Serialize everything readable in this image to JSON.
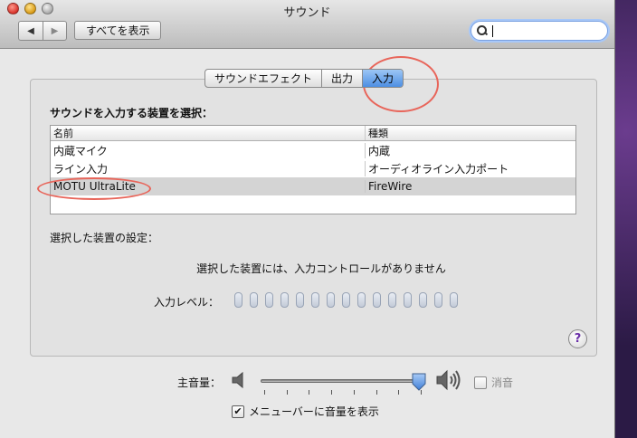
{
  "window": {
    "title": "サウンド"
  },
  "toolbar": {
    "back_glyph": "◀",
    "forward_glyph": "▶",
    "show_all_label": "すべてを表示",
    "search_value": ""
  },
  "tabs": [
    {
      "label": "サウンドエフェクト",
      "active": false
    },
    {
      "label": "出力",
      "active": false
    },
    {
      "label": "入力",
      "active": true
    }
  ],
  "input": {
    "select_label": "サウンドを入力する装置を選択：",
    "columns": [
      "名前",
      "種類"
    ],
    "devices": [
      {
        "name": "内蔵マイク",
        "type": "内蔵",
        "selected": false
      },
      {
        "name": "ライン入力",
        "type": "オーディオライン入力ポート",
        "selected": false
      },
      {
        "name": "MOTU UltraLite",
        "type": "FireWire",
        "selected": true
      }
    ],
    "settings_label": "選択した装置の設定：",
    "no_controls_text": "選択した装置には、入力コントロールがありません",
    "level_label": "入力レベル：",
    "level_segments": 15,
    "level_active_segments": 0
  },
  "help": {
    "glyph": "?"
  },
  "volume": {
    "label": "主音量：",
    "level_fraction": 0.97,
    "mute_label": "消音",
    "mute_checked": false,
    "mute_check_glyph": "",
    "menubar_label": "メニューバーに音量を表示",
    "menubar_checked": true,
    "menubar_check_glyph": "✔"
  },
  "colors": {
    "annotation": "#e8655a",
    "active_tab": "#4d8fe3"
  }
}
